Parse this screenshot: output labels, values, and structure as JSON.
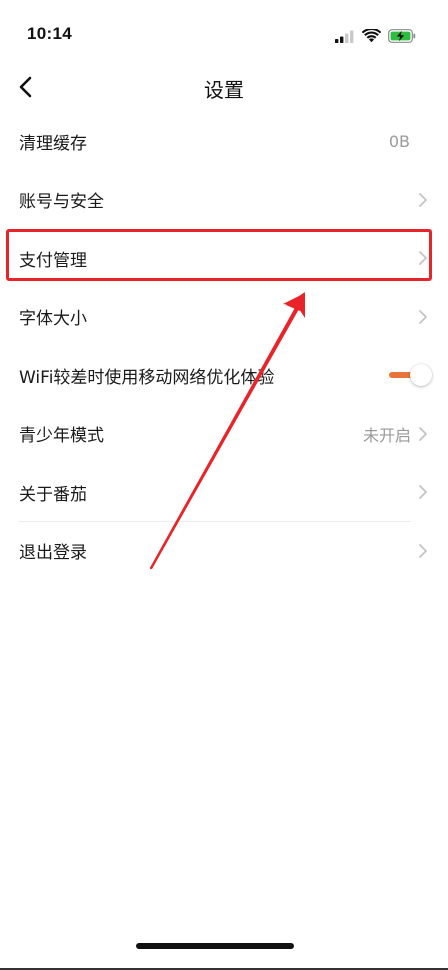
{
  "status_bar": {
    "time": "10:14",
    "icons": [
      "cellular-signal-icon",
      "wifi-icon",
      "battery-charging-icon"
    ],
    "battery_color": "#2ebd3e"
  },
  "nav": {
    "title": "设置",
    "back_icon": "chevron-left-icon"
  },
  "settings": {
    "items": [
      {
        "label": "清理缓存",
        "value": "0B",
        "control": "value"
      },
      {
        "label": "账号与安全",
        "control": "chevron"
      },
      {
        "label": "支付管理",
        "control": "chevron",
        "highlighted": true
      },
      {
        "label": "字体大小",
        "control": "chevron"
      },
      {
        "label": "WiFi较差时使用移动网络优化体验",
        "control": "toggle",
        "toggle_on": true
      },
      {
        "label": "青少年模式",
        "value": "未开启",
        "control": "chevron"
      },
      {
        "label": "关于番茄",
        "control": "chevron"
      },
      {
        "label": "退出登录",
        "control": "chevron"
      }
    ]
  },
  "colors": {
    "accent": "#e8743a",
    "annotation_red": "#e8242a",
    "secondary_text": "#9a9a9a"
  }
}
